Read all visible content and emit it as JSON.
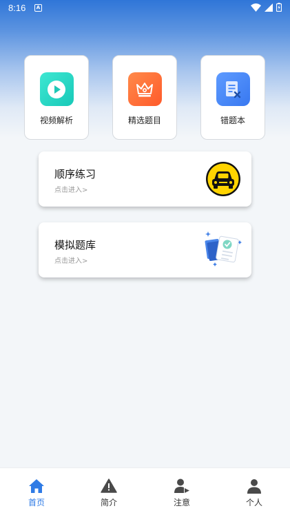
{
  "status_bar": {
    "time": "8:16",
    "notif_glyph": "A"
  },
  "features": [
    {
      "label": "视频解析",
      "icon": "play-icon",
      "color": "#22d3c0"
    },
    {
      "label": "精选题目",
      "icon": "crown-icon",
      "color": "#ff6a35"
    },
    {
      "label": "错题本",
      "icon": "wrong-book-icon",
      "color": "#4a89f8"
    }
  ],
  "practice": [
    {
      "title": "顺序练习",
      "subtitle": "点击进入>",
      "icon": "car-icon"
    },
    {
      "title": "模拟题库",
      "subtitle": "点击进入>",
      "icon": "exam-paper-icon"
    }
  ],
  "nav": [
    {
      "label": "首页",
      "icon": "home-icon",
      "active": true
    },
    {
      "label": "简介",
      "icon": "warning-icon",
      "active": false
    },
    {
      "label": "注意",
      "icon": "person-play-icon",
      "active": false
    },
    {
      "label": "个人",
      "icon": "person-icon",
      "active": false
    }
  ],
  "colors": {
    "accent": "#2f7be5",
    "header_blue": "#2f76d8"
  }
}
